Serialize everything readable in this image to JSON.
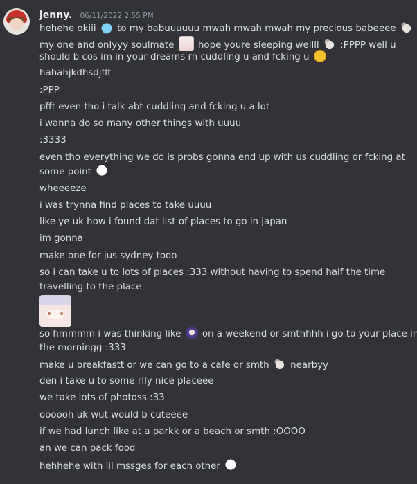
{
  "message": {
    "username": "jenny.",
    "timestamp": "06/11/2022 2:55 PM",
    "lines": [
      {
        "segments": [
          "hehehe okiii",
          "to my babuuuuuu mwah mwah mwah my precious babeeee"
        ],
        "emojis": [
          "blue-creature-emoji",
          "bear-emoji"
        ]
      },
      {
        "segments": [
          "my one and onlyyy soulmate",
          "hope youre sleeping wellll",
          ":PPPP well u"
        ],
        "emojis": [
          "anime-girl-emoji",
          "bear-emoji"
        ]
      },
      {
        "segments": [
          "should b cos im in your dreams rn cuddling u and fcking u"
        ],
        "emojis": [
          "woozy-face-emoji"
        ]
      },
      {
        "segments": [
          "hahahjkdhsdjflf"
        ]
      },
      {
        "segments": [
          ":PPP"
        ]
      },
      {
        "segments": [
          "pfft even tho i talk abt cuddling and fcking u a lot"
        ]
      },
      {
        "segments": [
          "i wanna do so many other things with uuuu"
        ]
      },
      {
        "segments": [
          ":3333"
        ]
      },
      {
        "segments": [
          "even tho everything we do is probs gonna end up with us cuddling or fcking at"
        ]
      },
      {
        "segments": [
          "some point"
        ],
        "emojis": [
          "ghost-emoji"
        ]
      },
      {
        "segments": [
          "wheeeeze"
        ]
      },
      {
        "segments": [
          "i was trynna find places to take uuuu"
        ]
      },
      {
        "segments": [
          "like ye uk how i found dat list of places to go in japan"
        ]
      },
      {
        "segments": [
          "im gonna"
        ]
      },
      {
        "segments": [
          "make one for jus sydney tooo"
        ]
      },
      {
        "segments": [
          "so i can take u to lots of places :333 without having to spend half the time"
        ]
      },
      {
        "segments": [
          "travelling to the place"
        ]
      },
      {
        "sticker": "anime-girl-sticker"
      },
      {
        "segments": [
          "so hmmmm i was thinking like",
          "on a weekend or smthhhh i go to your place in"
        ],
        "emojis": [
          "purple-hair-girl-emoji"
        ]
      },
      {
        "segments": [
          "the morningg :333"
        ]
      },
      {
        "segments": [
          "make u breakfastt or we can go to a cafe or smth",
          "nearbyy"
        ],
        "emojis": [
          "bear-emoji"
        ]
      },
      {
        "segments": [
          "den i take u to some rlly nice placeee"
        ]
      },
      {
        "segments": [
          "we take lots of photoss :33"
        ]
      },
      {
        "segments": [
          "oooooh uk wut would b cuteeee"
        ]
      },
      {
        "segments": [
          "if we had lunch like at a parkk or a beach or smth :OOOO"
        ]
      },
      {
        "segments": [
          "an we can pack food"
        ]
      },
      {
        "segments": [
          "hehhehe with lil mssges for each other"
        ],
        "emojis": [
          "ghost-emoji"
        ]
      }
    ]
  }
}
